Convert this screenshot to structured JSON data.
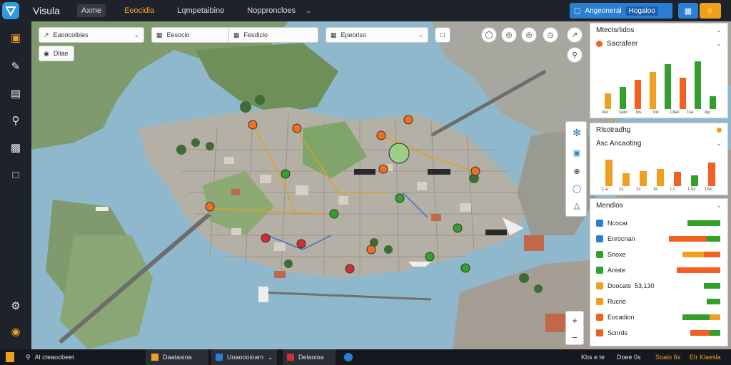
{
  "app": {
    "name": "Visula"
  },
  "nav": [
    {
      "label": "Axme",
      "active": true
    },
    {
      "label": "Eeocidla",
      "accent": "#f0a030"
    },
    {
      "label": "Lqmpetaibino"
    },
    {
      "label": "Nopproncloes",
      "dropdown": true
    }
  ],
  "top_actions": {
    "primary_label": "Angeoneral",
    "chip": "Hogaloo"
  },
  "search_bar": [
    {
      "label": "Eaoocoibies"
    },
    {
      "label": "Eesocio"
    },
    {
      "label": "Fesdicio"
    },
    {
      "label": "Epeoriso"
    }
  ],
  "map_filter": {
    "label": "Dllae"
  },
  "panel_top": {
    "title": "Mtectsrlidos",
    "subtitle": "Sacrafeer",
    "ticks": [
      "Ato",
      "cato",
      "ibs",
      "Iox",
      "Lbac",
      "tsa",
      "ikp"
    ],
    "bars": [
      {
        "v": 0.3,
        "c": "#f0a020"
      },
      {
        "v": 0.42,
        "c": "#34a02c"
      },
      {
        "v": 0.55,
        "c": "#f06020"
      },
      {
        "v": 0.7,
        "c": "#f0a020"
      },
      {
        "v": 0.85,
        "c": "#34a02c"
      },
      {
        "v": 0.6,
        "c": "#f06020"
      },
      {
        "v": 0.9,
        "c": "#34a02c"
      },
      {
        "v": 0.25,
        "c": "#34a02c"
      }
    ]
  },
  "panel_mid": {
    "title": "Rlsotradhg",
    "subtitle": "Asc Ancaoting",
    "ticks": [
      "1.a",
      "1s",
      "1s",
      "3s",
      "Ls",
      "1,0s",
      "1Ns"
    ],
    "bars": [
      {
        "v": 0.85,
        "c": "#f0a020"
      },
      {
        "v": 0.4,
        "c": "#f0a020"
      },
      {
        "v": 0.48,
        "c": "#f0a020"
      },
      {
        "v": 0.55,
        "c": "#f0a020"
      },
      {
        "v": 0.45,
        "c": "#f06020"
      },
      {
        "v": 0.35,
        "c": "#34a02c"
      },
      {
        "v": 0.75,
        "c": "#f06020"
      }
    ]
  },
  "panel_bottom": {
    "title": "Mendlos",
    "rows": [
      {
        "label": "Ncocar",
        "icon": "#2a7fd4",
        "bars": [
          {
            "v": 0.6,
            "c": "#34a02c"
          }
        ]
      },
      {
        "label": "Enrocnan",
        "icon": "#2a7fd4",
        "bars": [
          {
            "v": 0.7,
            "c": "#f06020"
          },
          {
            "v": 0.25,
            "c": "#34a02c"
          }
        ]
      },
      {
        "label": "Snoxe",
        "icon": "#34a02c",
        "bars": [
          {
            "v": 0.4,
            "c": "#f0a020"
          },
          {
            "v": 0.3,
            "c": "#f06020"
          }
        ]
      },
      {
        "label": "Aniste",
        "icon": "#34a02c",
        "bars": [
          {
            "v": 0.8,
            "c": "#f06020"
          }
        ]
      },
      {
        "label": "Doocats",
        "icon": "#f0a020",
        "value": "53,130",
        "bars": [
          {
            "v": 0.3,
            "c": "#34a02c"
          }
        ]
      },
      {
        "label": "Rucrio",
        "icon": "#f0a020",
        "bars": [
          {
            "v": 0.25,
            "c": "#34a02c"
          }
        ]
      },
      {
        "label": "Eocadion",
        "icon": "#f06020",
        "bars": [
          {
            "v": 0.5,
            "c": "#34a02c"
          },
          {
            "v": 0.2,
            "c": "#f0a020"
          }
        ]
      },
      {
        "label": "Scnrds",
        "icon": "#f06020",
        "bars": [
          {
            "v": 0.35,
            "c": "#f06020"
          },
          {
            "v": 0.2,
            "c": "#34a02c"
          }
        ]
      }
    ]
  },
  "taskbar": {
    "search": "Al cteaoobeet",
    "apps": [
      "Daatasioa",
      "Uoaoooioam",
      "Delaoioa"
    ],
    "tray": [
      "Kbs e te",
      "Doee 0s",
      "Soaio 6s",
      "Etr Klaesla"
    ]
  },
  "scale": "7",
  "colors": {
    "accent_blue": "#2a7fd4",
    "accent_orange": "#f0a020",
    "accent_green": "#34a02c",
    "accent_red": "#f06020"
  }
}
